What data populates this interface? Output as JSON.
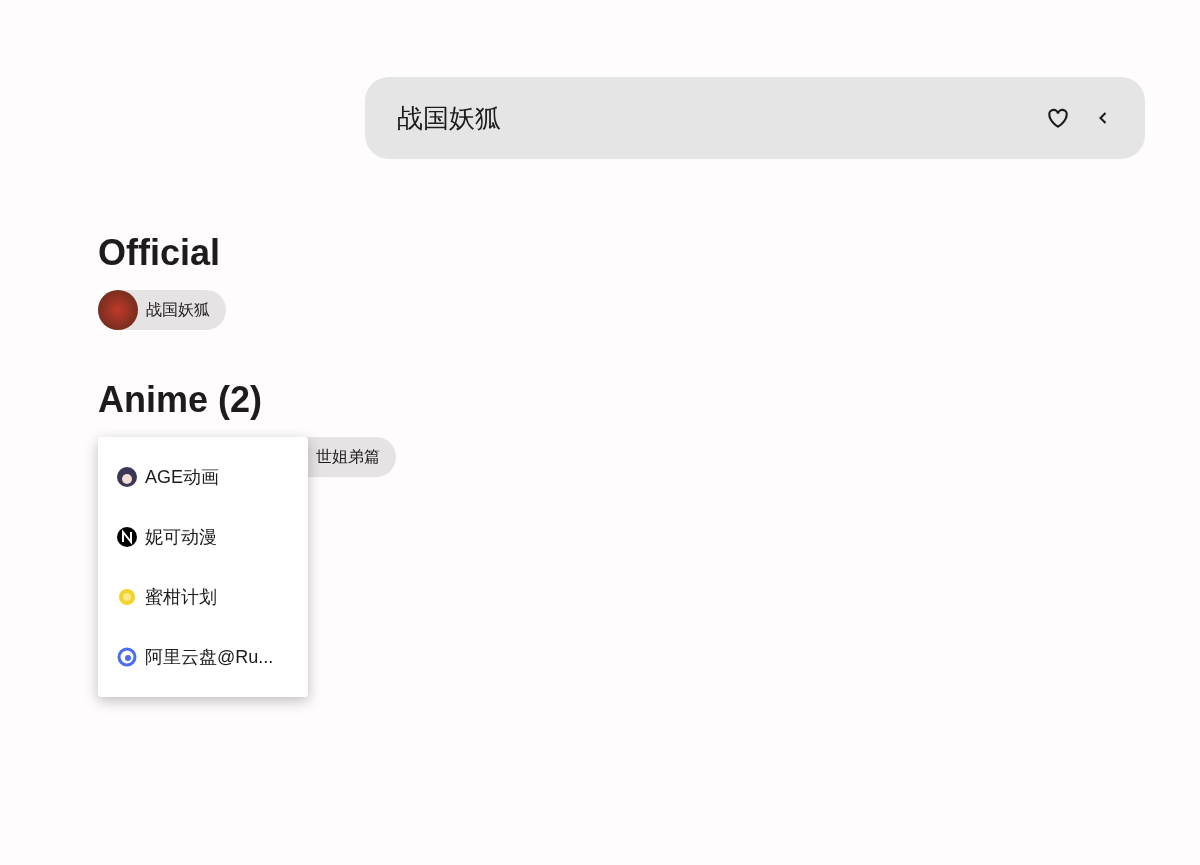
{
  "search_bar": {
    "value": "战国妖狐",
    "favorite": false
  },
  "sections": [
    {
      "title": "Official",
      "chips": [
        {
          "label": "战国妖狐",
          "kind": "avatar"
        }
      ]
    },
    {
      "title": "Anime (2)",
      "chips": [
        {
          "kind": "covered"
        },
        {
          "label": "世姐弟篇",
          "kind": "covered"
        }
      ]
    }
  ],
  "menu": {
    "items": [
      {
        "label": "AGE动画",
        "kind": "avatar"
      },
      {
        "label": "妮可动漫",
        "kind": "letter"
      },
      {
        "label": "蜜柑计划",
        "kind": "citrus"
      },
      {
        "label": "阿里云盘@Ru...",
        "kind": "cloud"
      }
    ]
  }
}
